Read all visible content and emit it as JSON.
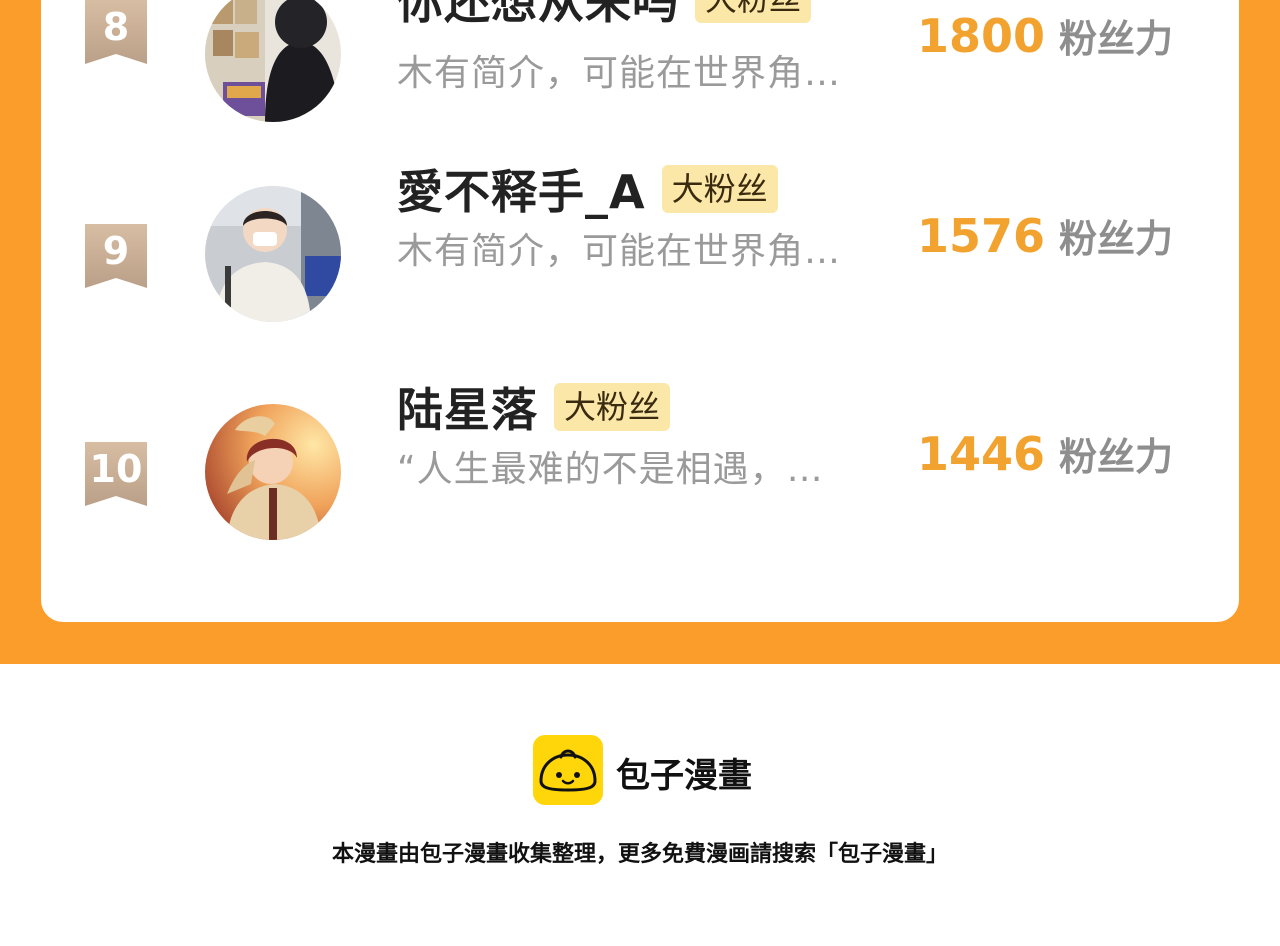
{
  "colors": {
    "frame": "#fb9d2a",
    "card": "#ffffff",
    "score": "#f2a32f",
    "badge": "#c9ad92",
    "tag_bg": "#fbe8a8",
    "logo_bg": "#ffd60a"
  },
  "ranking": {
    "rows": [
      {
        "rank": "8",
        "name": "你还想从来吗",
        "tag": "大粉丝",
        "bio": "木有简介，可能在世界角…",
        "score": "1800",
        "unit": "粉丝力",
        "avatar_icon": "avatar-photo-icon"
      },
      {
        "rank": "9",
        "name": "愛不释手_A",
        "tag": "大粉丝",
        "bio": "木有简介，可能在世界角…",
        "score": "1576",
        "unit": "粉丝力",
        "avatar_icon": "avatar-photo-icon"
      },
      {
        "rank": "10",
        "name": "陆星落",
        "tag": "大粉丝",
        "bio": "“人生最难的不是相遇，…",
        "score": "1446",
        "unit": "粉丝力",
        "avatar_icon": "avatar-illustration-icon"
      }
    ]
  },
  "footer": {
    "brand": "包子漫畫",
    "note": "本漫畫由包子漫畫收集整理，更多免費漫画請搜索「包子漫畫」",
    "logo_icon": "baozi-logo-icon"
  }
}
